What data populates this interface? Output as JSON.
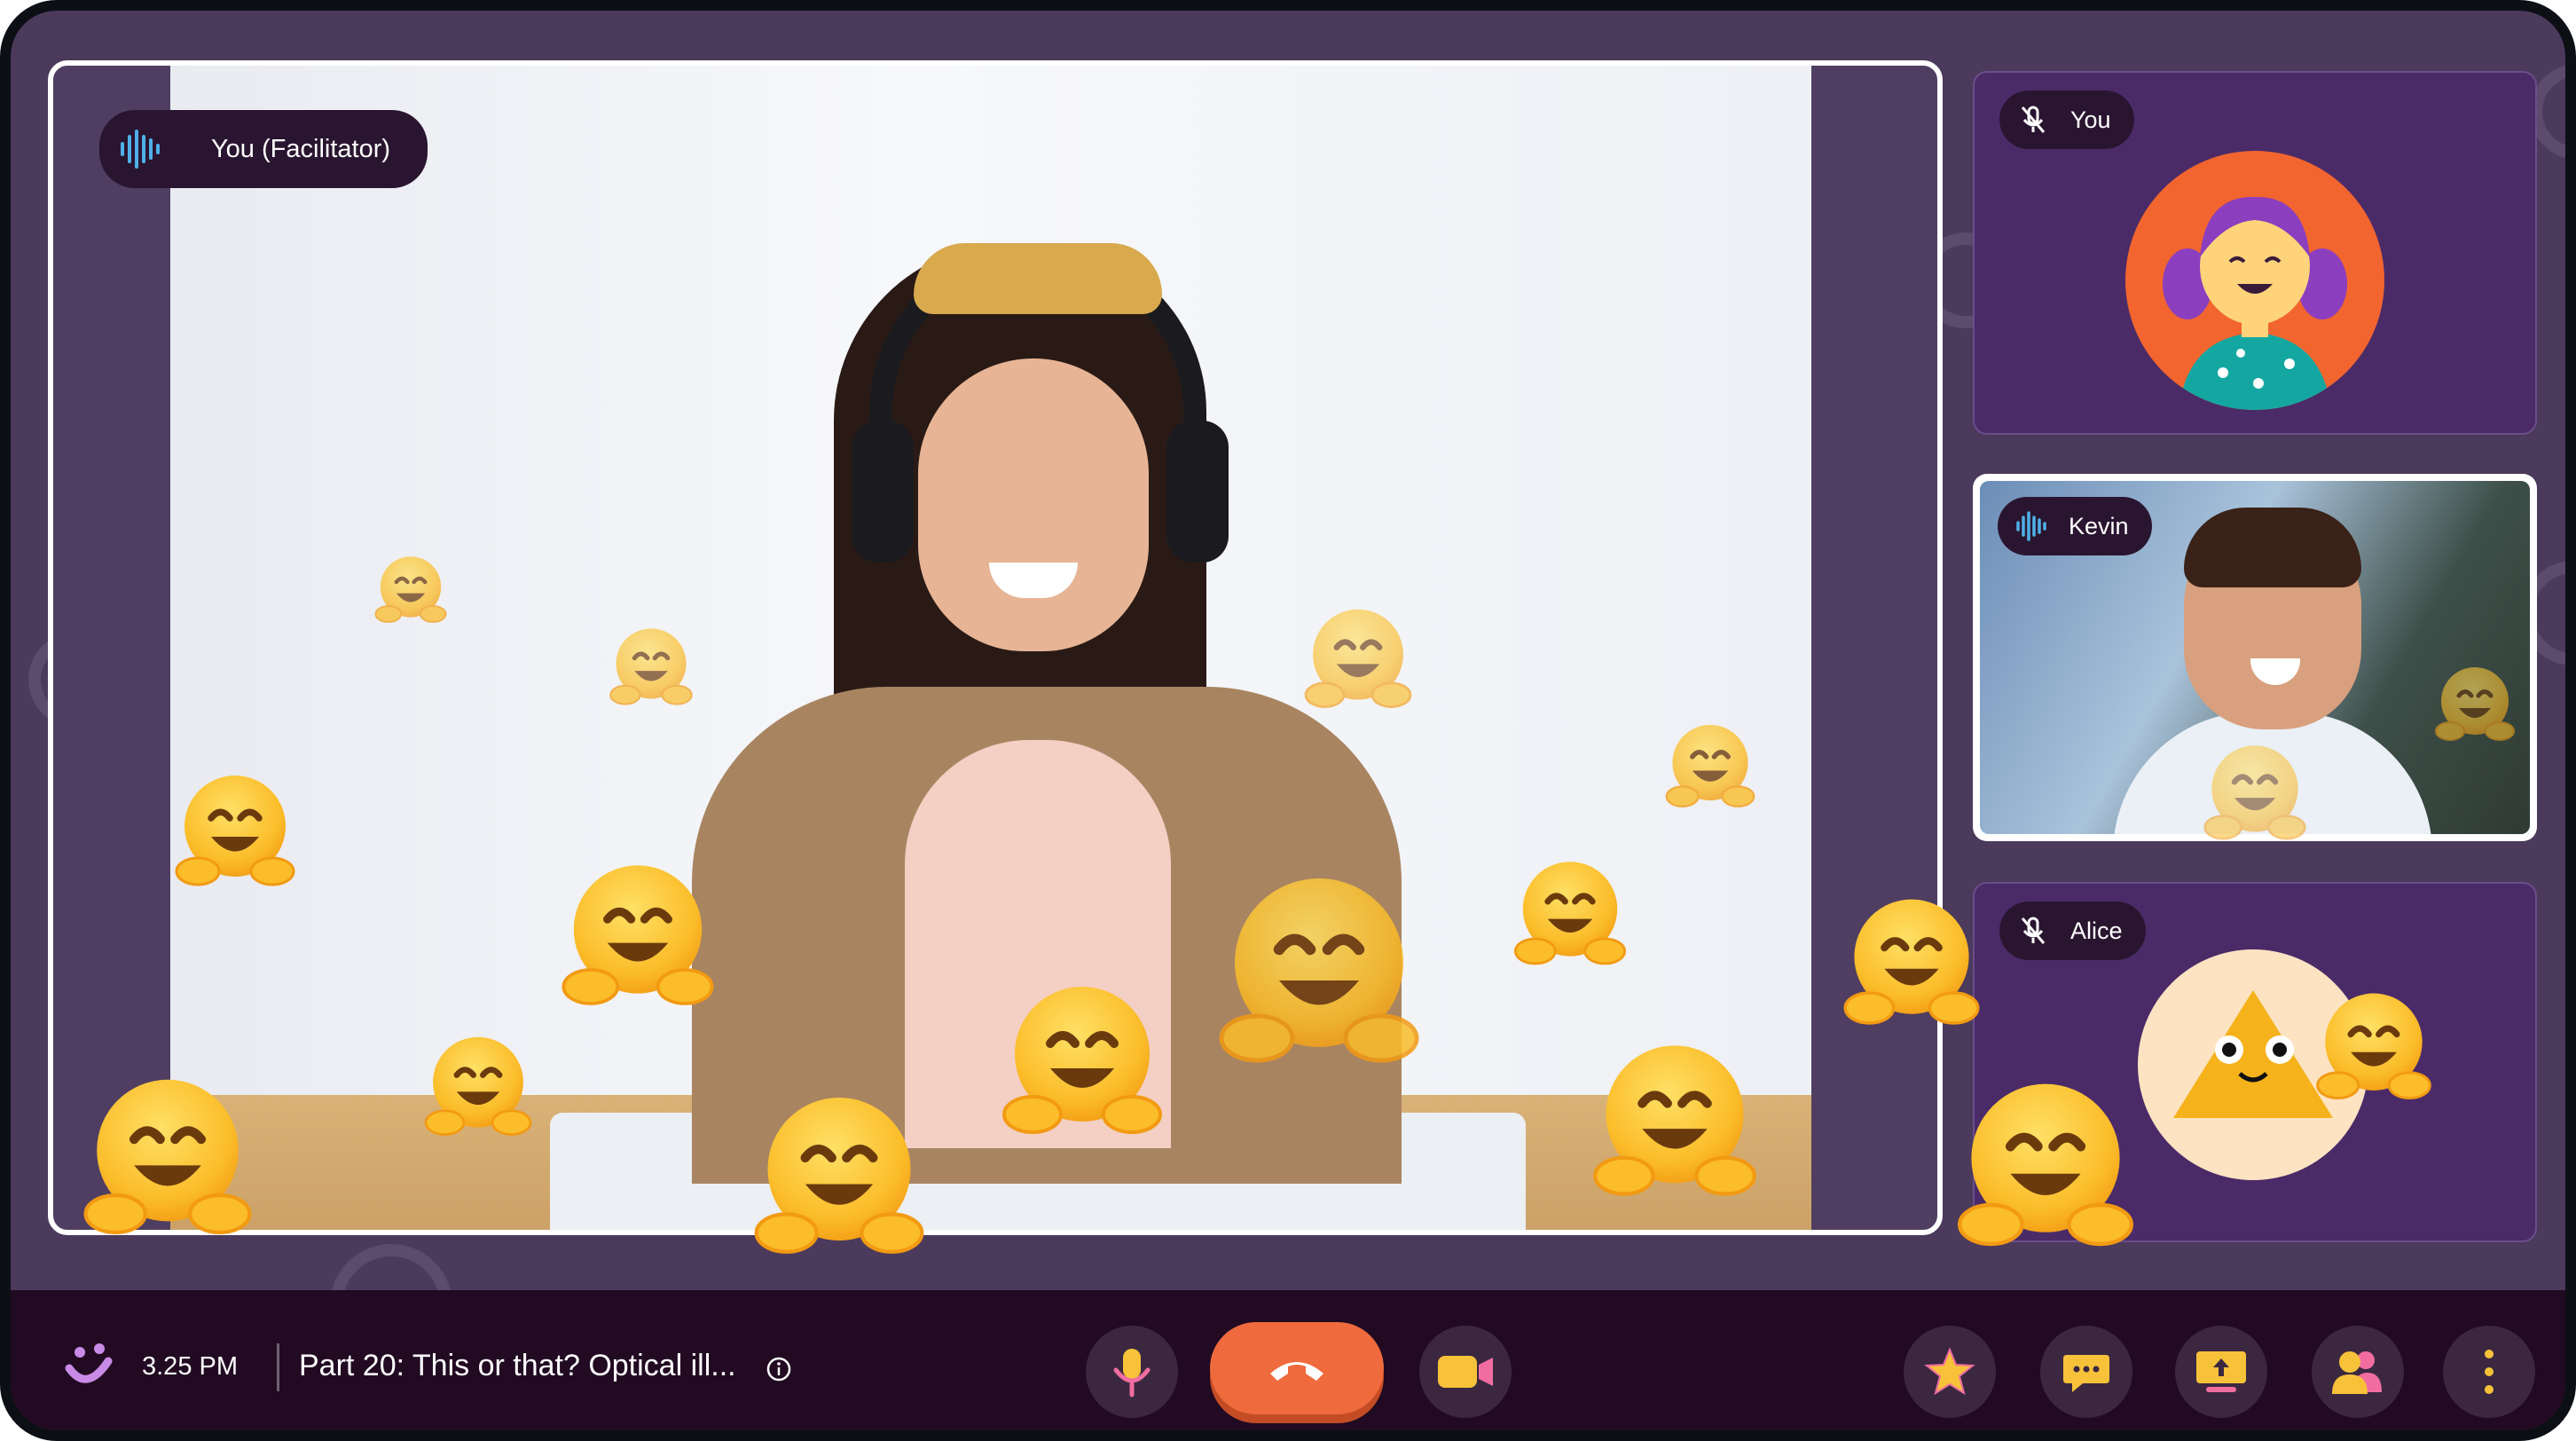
{
  "participants": {
    "main": {
      "name": "You (Facilitator)",
      "speaking_icon": "audio-wave-icon"
    },
    "you": {
      "name": "You",
      "mic_icon": "mic-muted-icon",
      "avatar": "girl-avatar-icon"
    },
    "kevin": {
      "name": "Kevin",
      "speaking_icon": "audio-wave-icon"
    },
    "alice": {
      "name": "Alice",
      "mic_icon": "mic-muted-icon",
      "avatar": "triangle-avatar-icon"
    }
  },
  "bottom_bar": {
    "time": "3.25 PM",
    "session_title": "Part 20: This or that? Optical ill...",
    "info_icon": "info-icon",
    "controls": {
      "mic_icon": "microphone-icon",
      "end_call_icon": "phone-hangup-icon",
      "camera_icon": "video-camera-icon",
      "reactions_icon": "star-icon",
      "chat_icon": "chat-bubble-icon",
      "share_icon": "screen-share-icon",
      "people_icon": "participants-icon",
      "more_icon": "more-vertical-icon"
    }
  },
  "reaction_emoji": "hugging-face",
  "colors": {
    "frame_bg": "#4b3a5c",
    "tile_purple": "#4a2b68",
    "bottom_bar": "#210a22",
    "end_call": "#ef6a3d",
    "accent_yellow": "#f7c23a",
    "accent_pink": "#f16da0"
  }
}
